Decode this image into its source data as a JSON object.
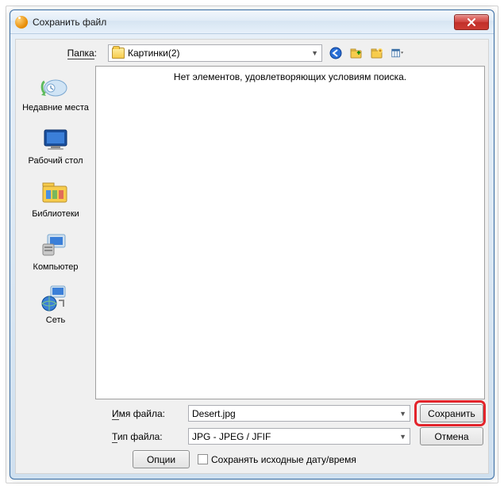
{
  "window": {
    "title": "Сохранить файл"
  },
  "folder": {
    "label": "Папка",
    "value": "Картинки(2)"
  },
  "file_area": {
    "empty_message": "Нет элементов, удовлетворяющих условиям поиска."
  },
  "places": {
    "recent": "Недавние места",
    "desktop": "Рабочий стол",
    "libraries": "Библиотеки",
    "computer": "Компьютер",
    "network": "Сеть"
  },
  "filename": {
    "label_pre": "И",
    "label_post": "мя файла:",
    "value": "Desert.jpg"
  },
  "filetype": {
    "label_pre": "Т",
    "label_post": "ип файла:",
    "value": "JPG - JPEG / JFIF"
  },
  "buttons": {
    "save": "Сохранить",
    "cancel": "Отмена",
    "options": "Опции"
  },
  "checkbox": {
    "preserve_date": "Сохранять исходные дату/время"
  }
}
